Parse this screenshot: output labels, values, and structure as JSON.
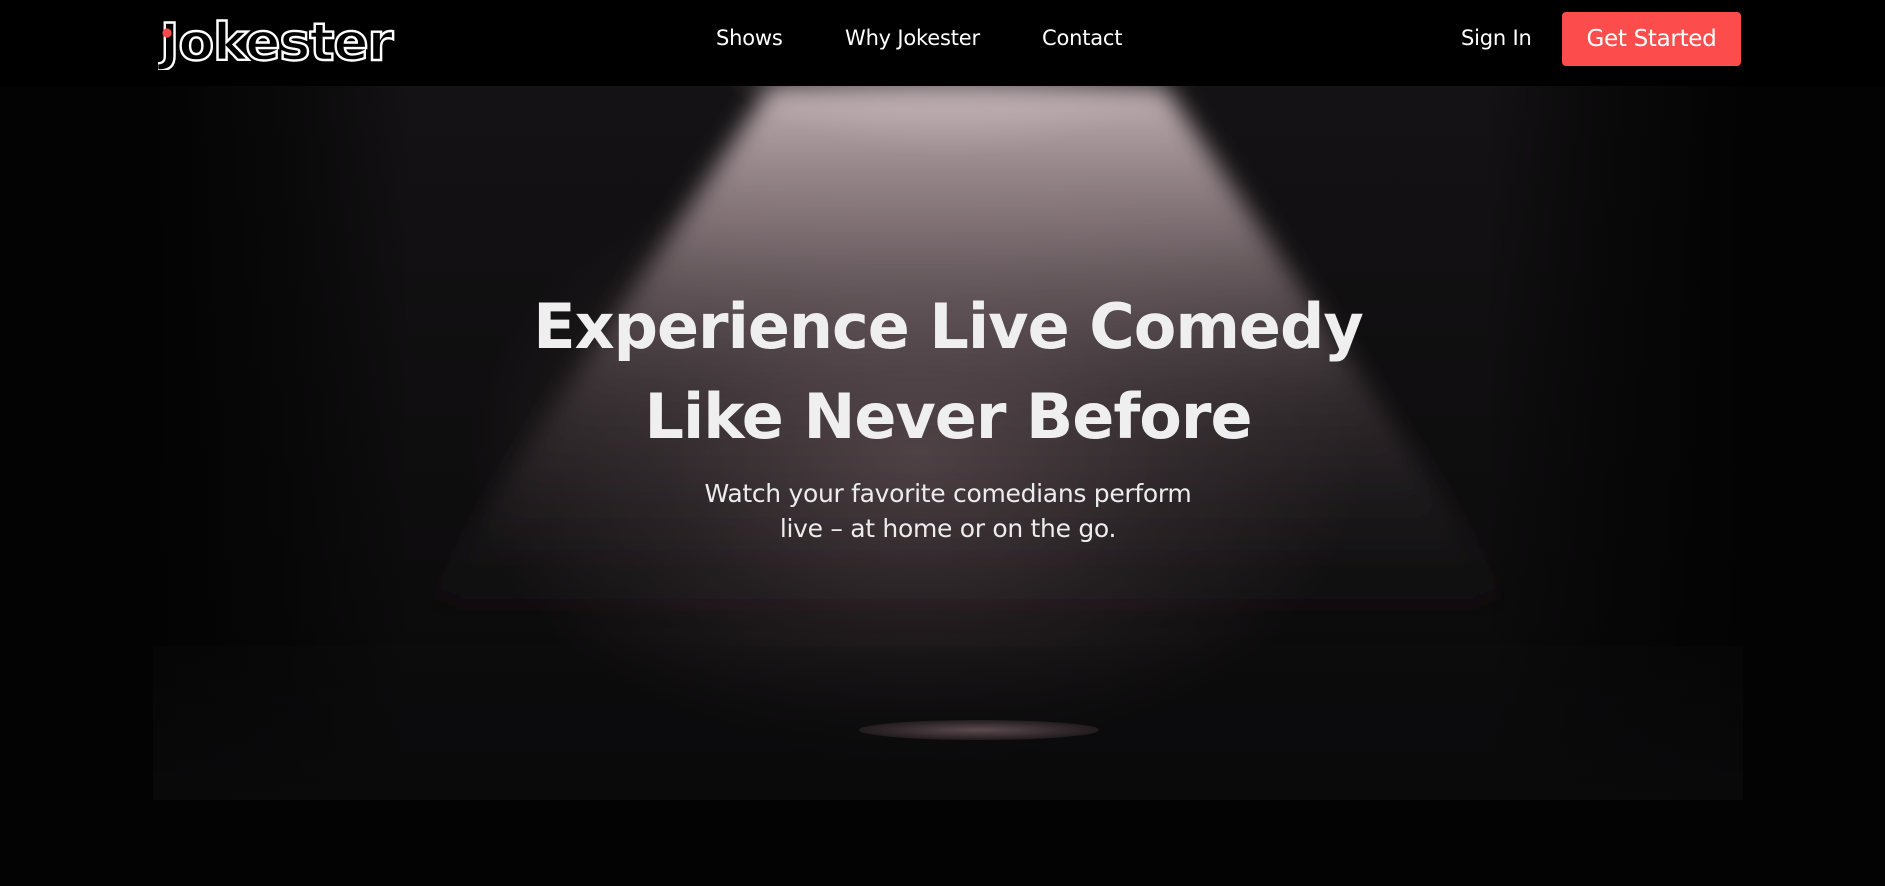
{
  "brand": {
    "name": "Jokester",
    "accent_color": "#fd4c4c",
    "dot_color": "#ff4a4a"
  },
  "nav": {
    "links": [
      {
        "label": "Shows"
      },
      {
        "label": "Why Jokester"
      },
      {
        "label": "Contact"
      }
    ],
    "sign_in_label": "Sign In",
    "cta_label": "Get Started"
  },
  "hero": {
    "headline_line1": "Experience Live Comedy",
    "headline_line2": "Like Never Before",
    "subtitle_line1": "Watch your favorite comedians perform",
    "subtitle_line2": "live – at home or on the go."
  }
}
